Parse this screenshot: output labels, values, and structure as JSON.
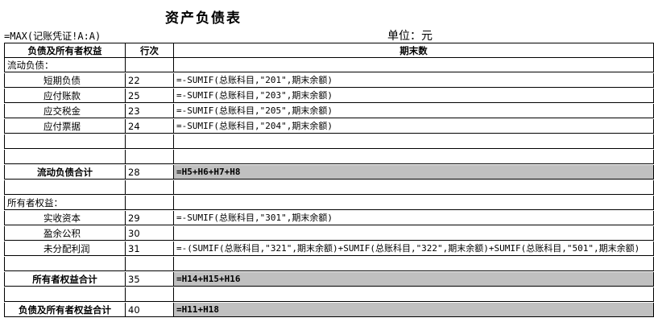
{
  "sheet": {
    "title": "资产负债表",
    "formula_top": "=MAX(记账凭证!A:A)",
    "unit": "单位：元",
    "headers": {
      "col1": "负债及所有者权益",
      "col2": "行次",
      "col3": "期末数"
    },
    "rows": [
      {
        "label": "流动负债：",
        "line": "",
        "formula": ""
      },
      {
        "label": "短期负债",
        "line": "22",
        "formula": "=-SUMIF(总账科目,\"201\",期末余额)"
      },
      {
        "label": "应付账款",
        "line": "25",
        "formula": "=-SUMIF(总账科目,\"203\",期末余额)"
      },
      {
        "label": "应交税金",
        "line": "23",
        "formula": "=-SUMIF(总账科目,\"205\",期末余额)"
      },
      {
        "label": "应付票据",
        "line": "24",
        "formula": "=-SUMIF(总账科目,\"204\",期末余额)"
      },
      {
        "label": "",
        "line": "",
        "formula": ""
      },
      {
        "label": "",
        "line": "",
        "formula": ""
      },
      {
        "label": "流动负债合计",
        "line": "28",
        "formula": "=H5+H6+H7+H8"
      },
      {
        "label": "",
        "line": "",
        "formula": ""
      },
      {
        "label": "所有者权益：",
        "line": "",
        "formula": ""
      },
      {
        "label": "实收资本",
        "line": "29",
        "formula": "=-SUMIF(总账科目,\"301\",期末余额)"
      },
      {
        "label": "盈余公积",
        "line": "30",
        "formula": ""
      },
      {
        "label": "未分配利润",
        "line": "31",
        "formula": "=-(SUMIF(总账科目,\"321\",期末余额)+SUMIF(总账科目,\"322\",期末余额)+SUMIF(总账科目,\"501\",期末余额)"
      },
      {
        "label": "",
        "line": "",
        "formula": ""
      },
      {
        "label": "所有者权益合计",
        "line": "35",
        "formula": "=H14+H15+H16"
      },
      {
        "label": "",
        "line": "",
        "formula": ""
      },
      {
        "label": "负债及所有者权益合计",
        "line": "40",
        "formula": "=H11+H18"
      }
    ]
  },
  "colors": {
    "total_fill": "#c0c0c0",
    "grid": "#d4d4d4"
  }
}
